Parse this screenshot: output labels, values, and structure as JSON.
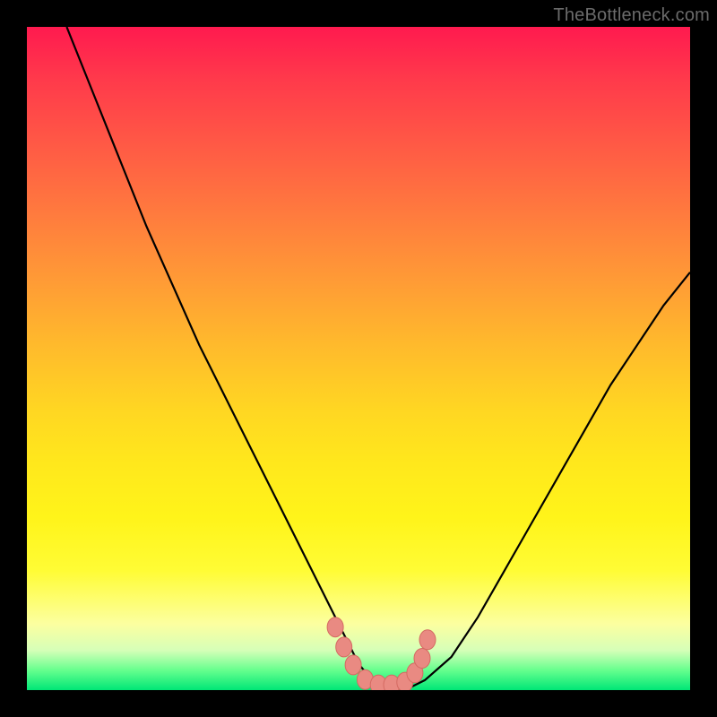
{
  "watermark": "TheBottleneck.com",
  "colors": {
    "frame": "#000000",
    "curve": "#000000",
    "markers_fill": "#e98a82",
    "markers_stroke": "#d46a62",
    "green": "#00e676",
    "red": "#ff1a4f"
  },
  "chart_data": {
    "type": "line",
    "title": "",
    "xlabel": "",
    "ylabel": "",
    "xlim": [
      0,
      100
    ],
    "ylim": [
      0,
      100
    ],
    "grid": false,
    "legend": false,
    "note": "Values estimated from pixels; x is horizontal position (0–100 left→right), y is bottleneck percentage (0 at bottom/green, 100 at top/red).",
    "series": [
      {
        "name": "bottleneck-curve",
        "x": [
          6,
          10,
          14,
          18,
          22,
          26,
          30,
          34,
          38,
          42,
          46,
          48,
          50,
          52,
          54,
          56,
          58,
          60,
          64,
          68,
          72,
          76,
          80,
          84,
          88,
          92,
          96,
          100
        ],
        "y": [
          100,
          90,
          80,
          70,
          61,
          52,
          44,
          36,
          28,
          20,
          12,
          8,
          4,
          1.5,
          0.5,
          0.5,
          0.5,
          1.5,
          5,
          11,
          18,
          25,
          32,
          39,
          46,
          52,
          58,
          63
        ]
      }
    ],
    "markers": {
      "name": "highlight-points",
      "x": [
        46.5,
        47.8,
        49.2,
        51.0,
        53.0,
        55.0,
        57.0,
        58.5,
        59.6,
        60.4
      ],
      "y": [
        9.5,
        6.5,
        3.8,
        1.6,
        0.8,
        0.8,
        1.2,
        2.6,
        4.8,
        7.6
      ]
    }
  }
}
